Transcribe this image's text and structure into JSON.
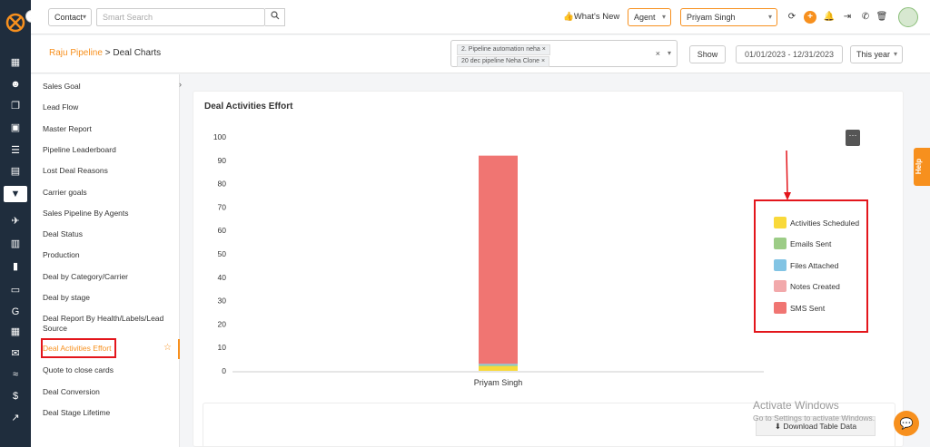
{
  "rail": {
    "icons": [
      "dashboard-icon",
      "contacts-icon",
      "copy-icon",
      "calendar-icon",
      "list-icon",
      "address-book-icon",
      "funnel-icon",
      "megaphone-icon",
      "document-icon",
      "bar-chart-icon",
      "folder-icon",
      "google-icon",
      "schedule-icon",
      "mail-icon",
      "handshake-icon",
      "dollar-icon",
      "trend-icon"
    ]
  },
  "topbar": {
    "module_select": "Contact",
    "search_placeholder": "Smart Search",
    "whats_new": "What's New",
    "role_select": "Agent",
    "user_select": "Priyam Singh"
  },
  "subheader": {
    "breadcrumb_root": "Raju Pipeline",
    "breadcrumb_sep": " > ",
    "breadcrumb_current": "Deal Charts",
    "pipelines": [
      "2. Pipeline automation neha",
      "20 dec pipeline Neha Clone"
    ],
    "show_label": "Show",
    "date_range": "01/01/2023 - 12/31/2023",
    "period_select": "This year"
  },
  "reports": [
    "Sales Goal",
    "Lead Flow",
    "Master Report",
    "Pipeline Leaderboard",
    "Lost Deal Reasons",
    "Carrier goals",
    "Sales Pipeline By Agents",
    "Deal Status",
    "Production",
    "Deal by Category/Carrier",
    "Deal by stage",
    "Deal Report By Health/Labels/Lead Source",
    "Deal Activities Effort",
    "Quote to close cards",
    "Deal Conversion",
    "Deal Stage Lifetime"
  ],
  "active_report": "Deal Activities Effort",
  "card": {
    "title": "Deal Activities Effort",
    "download_label": "Download Table Data"
  },
  "chart_data": {
    "type": "bar",
    "stacked": true,
    "categories": [
      "Priyam Singh"
    ],
    "ylim": [
      0,
      100
    ],
    "yticks": [
      0,
      10,
      20,
      30,
      40,
      50,
      60,
      70,
      80,
      90,
      100
    ],
    "grid": false,
    "legend_position": "right",
    "series": [
      {
        "name": "Activities Scheduled",
        "color": "#f9d93a",
        "values": [
          2
        ]
      },
      {
        "name": "Emails Sent",
        "color": "#9ccc86",
        "values": [
          0.5
        ]
      },
      {
        "name": "Files Attached",
        "color": "#82c4e4",
        "values": [
          0.5
        ]
      },
      {
        "name": "Notes Created",
        "color": "#f2a9ab",
        "values": [
          0
        ]
      },
      {
        "name": "SMS Sent",
        "color": "#f07572",
        "values": [
          89
        ]
      }
    ]
  },
  "help_label": "Help",
  "watermark": {
    "line1": "Activate Windows",
    "line2": "Go to Settings to activate Windows."
  }
}
